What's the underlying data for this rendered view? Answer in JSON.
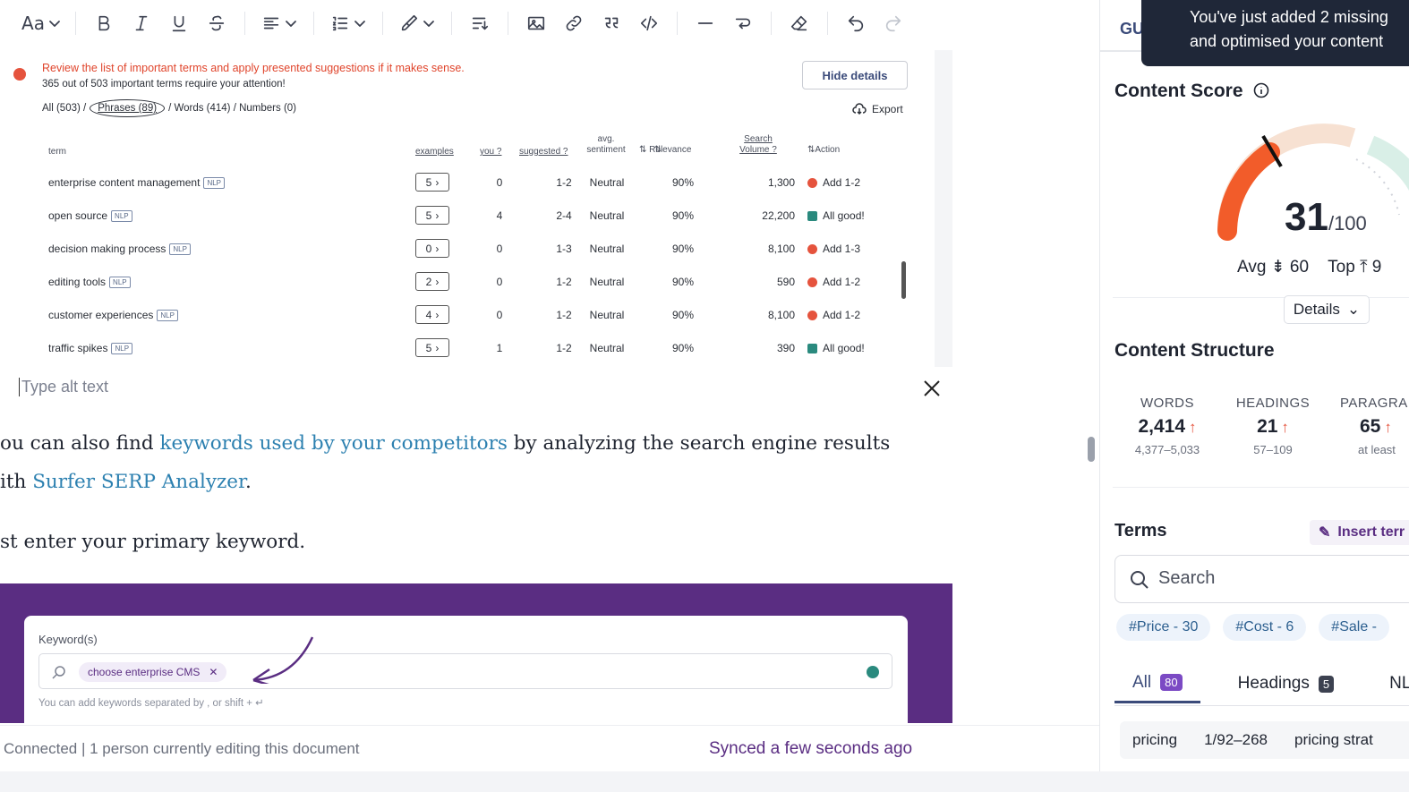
{
  "toolbar": {
    "font_label": "Aa",
    "items": [
      "bold",
      "italic",
      "underline",
      "strikethrough",
      "align",
      "list",
      "paint",
      "sort",
      "image",
      "link",
      "quote",
      "code",
      "horizontal-rule",
      "wrap",
      "clear-format",
      "undo",
      "redo"
    ]
  },
  "embedded": {
    "warn_title": "Review the list of important terms and apply presented suggestions if it makes sense.",
    "warn_sub": "365 out of 503 important terms require your attention!",
    "hide_details": "Hide details",
    "filter_all": "All (503) /",
    "filter_phrases": "Phrases (89)",
    "filter_words": "/ Words (414) / Numbers (0)",
    "export": "Export",
    "headers": {
      "term": "term",
      "examples": "examples",
      "you": "you ?",
      "suggested": "suggested ?",
      "sentiment": "avg. sentiment",
      "relevance": "Relevance",
      "volume": "Search Volume ?",
      "action": "Action"
    },
    "rows": [
      {
        "term": "enterprise content management",
        "nlp": "NLP",
        "ex": "5",
        "you": "0",
        "sug": "1-2",
        "sent": "Neutral",
        "rel": "90%",
        "vol": "1,300",
        "status": "red",
        "action": "Add 1-2"
      },
      {
        "term": "open source",
        "nlp": "NLP",
        "ex": "5",
        "you": "4",
        "sug": "2-4",
        "sent": "Neutral",
        "rel": "90%",
        "vol": "22,200",
        "status": "good",
        "action": "All good!"
      },
      {
        "term": "decision making process",
        "nlp": "NLP",
        "ex": "0",
        "you": "0",
        "sug": "1-3",
        "sent": "Neutral",
        "rel": "90%",
        "vol": "8,100",
        "status": "red",
        "action": "Add 1-3"
      },
      {
        "term": "editing tools",
        "nlp": "NLP",
        "ex": "2",
        "you": "0",
        "sug": "1-2",
        "sent": "Neutral",
        "rel": "90%",
        "vol": "590",
        "status": "red",
        "action": "Add 1-2"
      },
      {
        "term": "customer experiences",
        "nlp": "NLP",
        "ex": "4",
        "you": "0",
        "sug": "1-2",
        "sent": "Neutral",
        "rel": "90%",
        "vol": "8,100",
        "status": "red",
        "action": "Add 1-2"
      },
      {
        "term": "traffic spikes",
        "nlp": "NLP",
        "ex": "5",
        "you": "1",
        "sug": "1-2",
        "sent": "Neutral",
        "rel": "90%",
        "vol": "390",
        "status": "good",
        "action": "All good!"
      }
    ]
  },
  "alt_text": {
    "placeholder": "Type alt text"
  },
  "article": {
    "p1_a": "ou can also find ",
    "p1_link": "keywords used by your competitors",
    "p1_b": " by analyzing the search engine results",
    "p2_a": "ith ",
    "p2_link": "Surfer SERP Analyzer",
    "p2_b": ".",
    "p3": "st enter your primary keyword."
  },
  "keyword_image": {
    "label": "Keyword(s)",
    "chip": "choose enterprise CMS",
    "hint": "You can add keywords separated by  ,  or  shift  +  ↵"
  },
  "status": {
    "left": "Connected | 1 person currently editing this document",
    "right": "Synced a few seconds ago"
  },
  "right_panel": {
    "tab": "GU",
    "toast_line1": "You've just added 2 missing",
    "toast_line2": "and optimised your content",
    "content_score_title": "Content Score",
    "score": "31",
    "score_max": "/100",
    "avg_label": "Avg",
    "avg_value": "60",
    "top_label": "Top",
    "top_value": "9",
    "details": "Details",
    "structure_title": "Content Structure",
    "stats": [
      {
        "label": "WORDS",
        "value": "2,414",
        "range": "4,377–5,033"
      },
      {
        "label": "HEADINGS",
        "value": "21",
        "range": "57–109"
      },
      {
        "label": "PARAGRA",
        "value": "65",
        "range": "at least"
      }
    ],
    "terms_title": "Terms",
    "insert_terms": "Insert terr",
    "search_placeholder": "Search",
    "chips": [
      "#Price - 30",
      "#Cost - 6",
      "#Sale - "
    ],
    "tabs": [
      {
        "label": "All",
        "count": "80"
      },
      {
        "label": "Headings",
        "count": "5"
      },
      {
        "label": "NLP",
        "count": ""
      }
    ],
    "term_row": {
      "term": "pricing",
      "count": "1/92–268",
      "next": "pricing strat"
    }
  },
  "colors": {
    "accent_purple": "#5a2d82",
    "link_blue": "#2c80b0",
    "warning_red": "#e5533d",
    "gauge_orange": "#f25c2a"
  }
}
